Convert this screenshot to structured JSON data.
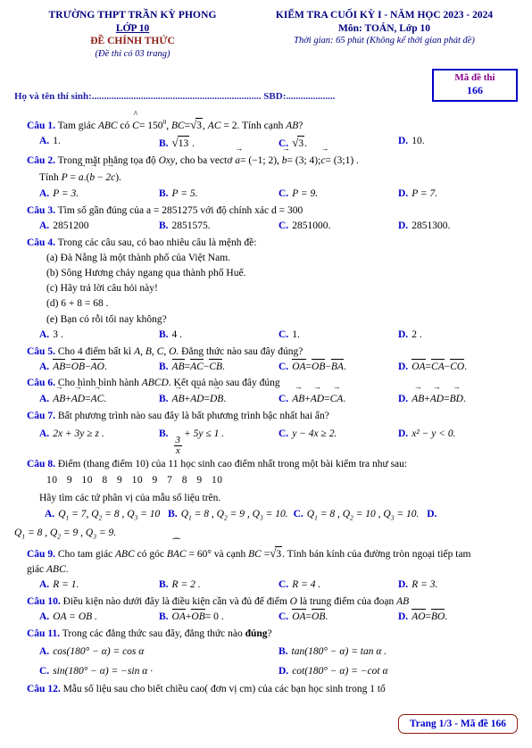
{
  "header": {
    "school": "TRƯỜNG THPT TRẦN KỲ PHONG",
    "grade": "LỚP 10",
    "official": "ĐỀ CHÍNH THỨC",
    "pages_note": "(Đề thi có 03 trang)",
    "exam_title": "KIỂM TRA CUỐI KỲ I - NĂM HỌC 2023 - 2024",
    "subject": "Môn: TOÁN, Lớp 10",
    "duration": "Thời gian: 65 phút (Không kể thời gian phát đề)",
    "name_field": "Họ và tên thí sinh:..................................................................... SBD:....................",
    "code_label": "Mã đề thi",
    "code_value": "166"
  },
  "colors": {
    "navy": "#000080",
    "blue": "#0000cc",
    "maroon": "#8b1a12",
    "purple": "#8b008b"
  },
  "questions": {
    "q1": {
      "label": "Câu 1.",
      "stem_a": "Tam giác",
      "stem_abc": "ABC",
      "stem_b": "có",
      "stem_c_hat": "C",
      "stem_eq1": "= 150",
      "stem_deg": "0",
      "stem_bc": "BC",
      "stem_eq2": "=",
      "stem_r3": "3",
      "stem_ac": "AC",
      "stem_eq3": "= 2. Tính cạnh",
      "stem_ab": "AB",
      "stem_q": "?",
      "options": [
        {
          "letter": "A.",
          "text": "1."
        },
        {
          "letter": "B.",
          "text": "13",
          "type": "sqrt"
        },
        {
          "letter": "C.",
          "text": "3",
          "type": "sqrt"
        },
        {
          "letter": "D.",
          "text": "10."
        }
      ]
    },
    "q2": {
      "label": "Câu 2.",
      "stem_1": "Trong mặt phẳng tọa độ",
      "oxy": "Oxy",
      "stem_2": ", cho ba vectơ",
      "a_val": "= (−1; 2),",
      "b_val": "= (3; 4);",
      "c_val": "= (3;1) .",
      "sub_line": "Tính",
      "sub_p": "P",
      "sub_eq": "=",
      "sub_a": "a",
      "sub_dot": ".",
      "sub_b": "b",
      "sub_minus": "−",
      "sub_2c": "2c",
      "options": [
        {
          "letter": "A.",
          "text": "P = 3."
        },
        {
          "letter": "B.",
          "text": "P = 5."
        },
        {
          "letter": "C.",
          "text": "P = 9."
        },
        {
          "letter": "D.",
          "text": "P = 7."
        }
      ]
    },
    "q3": {
      "label": "Câu 3.",
      "stem": "Tìm số gần đúng của a = 2851275 với độ chính xác d = 300",
      "options": [
        {
          "letter": "A.",
          "text": "2851200"
        },
        {
          "letter": "B.",
          "text": "2851575."
        },
        {
          "letter": "C.",
          "text": "2851000."
        },
        {
          "letter": "D.",
          "text": "2851300."
        }
      ]
    },
    "q4": {
      "label": "Câu 4.",
      "stem": "Trong các câu sau, có bao nhiêu câu là mệnh đề:",
      "items": [
        "(a) Đà Nẵng là một thành phố của Việt Nam.",
        "(b) Sông Hương chảy ngang qua thành phố Huế.",
        "(c) Hãy trả lời câu hỏi này!",
        "(d) 6 + 8 = 68 .",
        "(e) Bạn có rỗi tối nay không?"
      ],
      "options": [
        {
          "letter": "A.",
          "text": "3 ."
        },
        {
          "letter": "B.",
          "text": "4 ."
        },
        {
          "letter": "C.",
          "text": "1."
        },
        {
          "letter": "D.",
          "text": "2 ."
        }
      ]
    },
    "q5": {
      "label": "Câu 5.",
      "stem_1": "Cho 4 điểm bất kì",
      "points": "A, B, C, O",
      "stem_2": ". Đẳng thức nào sau đây đúng?",
      "options": [
        {
          "letter": "A.",
          "v": [
            "AB",
            "OB",
            "AO"
          ],
          "ops": [
            "=",
            "−"
          ]
        },
        {
          "letter": "B.",
          "v": [
            "AB",
            "AC",
            "CB"
          ],
          "ops": [
            "=",
            "−"
          ]
        },
        {
          "letter": "C.",
          "v": [
            "OA",
            "OB",
            "BA"
          ],
          "ops": [
            "=",
            "−"
          ]
        },
        {
          "letter": "D.",
          "v": [
            "OA",
            "CA",
            "CO"
          ],
          "ops": [
            "=",
            "−"
          ]
        }
      ]
    },
    "q6": {
      "label": "Câu 6.",
      "stem_1": "Cho hình bình hành",
      "abcd": "ABCD",
      "stem_2": ". Kết quả nào sau đây đúng",
      "options": [
        {
          "letter": "A.",
          "v": [
            "AB",
            "AD",
            "AC"
          ],
          "ops": [
            "+",
            "="
          ]
        },
        {
          "letter": "B.",
          "v": [
            "AB",
            "AD",
            "DB"
          ],
          "ops": [
            "+",
            "="
          ]
        },
        {
          "letter": "C.",
          "v": [
            "AB",
            "AD",
            "CA"
          ],
          "ops": [
            "+",
            "="
          ]
        },
        {
          "letter": "D.",
          "v": [
            "AB",
            "AD",
            "BD"
          ],
          "ops": [
            "+",
            "="
          ]
        }
      ]
    },
    "q7": {
      "label": "Câu 7.",
      "stem": "Bất phương trình nào sau đây là bất phương trình bậc nhất hai ẩn?",
      "options": [
        {
          "letter": "A.",
          "text": "2x + 3y ≥ z ."
        },
        {
          "letter": "B.",
          "text": "frac",
          "num": "3",
          "den": "x",
          "tail": "+ 5y ≤ 1 ."
        },
        {
          "letter": "C.",
          "text": "y − 4x ≥ 2."
        },
        {
          "letter": "D.",
          "text": "x² − y < 0."
        }
      ]
    },
    "q8": {
      "label": "Câu 8.",
      "stem": "Điểm (thang điểm 10) của 11 học sinh cao điểm nhất trong một bài kiểm tra như sau:",
      "data": "10  9  10  8  9  10  9  7  8  9  10",
      "ask": "Hãy tìm các tứ phân vị của mẫu số liệu trên.",
      "options": [
        {
          "letter": "A.",
          "q1": "7",
          "q2": "8",
          "q3": "10",
          "tail": ""
        },
        {
          "letter": "B.",
          "q1": "8",
          "q2": "9",
          "q3": "10",
          "tail": "."
        },
        {
          "letter": "C.",
          "q1": "8",
          "q2": "10",
          "q3": "10",
          "tail": "."
        },
        {
          "letter": "D.",
          "q1": "8",
          "q2": "9",
          "q3": "9",
          "tail": "."
        }
      ]
    },
    "q9": {
      "label": "Câu 9.",
      "stem_1": "Cho tam giác",
      "abc": "ABC",
      "stem_2": "có góc",
      "angle": "BAC",
      "stem_3": "= 60° và cạnh",
      "bc": "BC",
      "stem_4": "=",
      "r3": "3",
      "stem_5": ". Tính bán kính của đường tròn ngoại tiếp tam",
      "stem_6": "giác",
      "abc2": "ABC",
      "stem_7": ".",
      "options": [
        {
          "letter": "A.",
          "text": "R = 1."
        },
        {
          "letter": "B.",
          "text": "R = 2 ."
        },
        {
          "letter": "C.",
          "text": "R = 4 ."
        },
        {
          "letter": "D.",
          "text": "R = 3."
        }
      ]
    },
    "q10": {
      "label": "Câu 10.",
      "stem_1": "Điều kiện nào dưới đây là điều kiện cần và đủ để điểm",
      "o": "O",
      "stem_2": "là trung điểm của đoạn",
      "ab": "AB",
      "options": [
        {
          "letter": "A.",
          "plain": "OA = OB ."
        },
        {
          "letter": "B.",
          "v": [
            "OA",
            "OB"
          ],
          "ops": [
            "+",
            "= 0 ."
          ]
        },
        {
          "letter": "C.",
          "v": [
            "OA",
            "OB"
          ],
          "ops": [
            "=",
            "."
          ]
        },
        {
          "letter": "D.",
          "v": [
            "AO",
            "BO"
          ],
          "ops": [
            "=",
            "."
          ]
        }
      ]
    },
    "q11": {
      "label": "Câu 11.",
      "stem_1": "Trong các đẳng thức sau đây, đẳng thức nào",
      "bold_word": "đúng",
      "stem_2": "?",
      "options": [
        {
          "letter": "A.",
          "text": "cos(180° − α) = cos α"
        },
        {
          "letter": "B.",
          "text": "tan(180° − α) = tan α ."
        },
        {
          "letter": "C.",
          "text": "sin(180° − α) = −sin α ·"
        },
        {
          "letter": "D.",
          "text": "cot(180° − α) = −cot α"
        }
      ]
    },
    "q12": {
      "label": "Câu 12.",
      "stem": "Mẫu số liệu sau cho biết chiều cao( đơn vị cm) của các bạn học sinh trong 1 tổ"
    }
  },
  "footer": {
    "page_info": "Trang 1/3 - Mã đề 166"
  }
}
